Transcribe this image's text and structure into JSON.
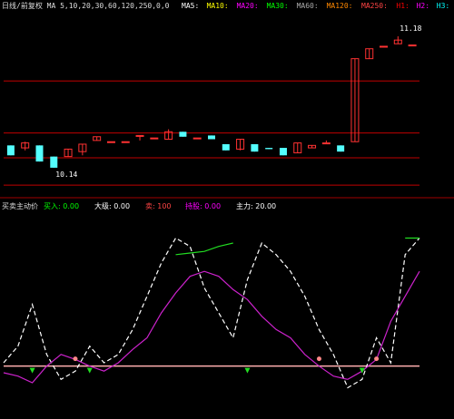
{
  "chart_data": [
    {
      "type": "candlestick",
      "panel": "price",
      "header": {
        "title": "日线/前复权",
        "ma_label": "MA",
        "ma_params": "5,10,20,30,60,120,250,0,0",
        "indicators": [
          {
            "text": "MA5:",
            "color": "#ffffff"
          },
          {
            "text": "MA10:",
            "color": "#ffff00"
          },
          {
            "text": "MA20:",
            "color": "#ff00ff"
          },
          {
            "text": "MA30:",
            "color": "#00ff00"
          },
          {
            "text": "MA60:",
            "color": "#aaaaaa"
          },
          {
            "text": "MA120:",
            "color": "#ff8800"
          },
          {
            "text": "MA250:",
            "color": "#ff4444"
          },
          {
            "text": "H1:",
            "color": "#ff0000"
          },
          {
            "text": "H2:",
            "color": "#ff00ff"
          },
          {
            "text": "H3:",
            "color": "#00ffff"
          },
          {
            "text": "H4:",
            "color": "#ffff00"
          }
        ]
      },
      "candles": [
        {
          "o": 10.3,
          "h": 10.3,
          "l": 10.22,
          "c": 10.22
        },
        {
          "o": 10.28,
          "h": 10.33,
          "l": 10.26,
          "c": 10.32
        },
        {
          "o": 10.3,
          "h": 10.3,
          "l": 10.17,
          "c": 10.17
        },
        {
          "o": 10.21,
          "h": 10.21,
          "l": 10.12,
          "c": 10.12
        },
        {
          "o": 10.21,
          "h": 10.27,
          "l": 10.21,
          "c": 10.27
        },
        {
          "o": 10.25,
          "h": 10.31,
          "l": 10.22,
          "c": 10.31
        },
        {
          "o": 10.34,
          "h": 10.37,
          "l": 10.34,
          "c": 10.37
        },
        {
          "o": 10.33,
          "h": 10.33,
          "l": 10.33,
          "c": 10.33
        },
        {
          "o": 10.33,
          "h": 10.33,
          "l": 10.33,
          "c": 10.33
        },
        {
          "o": 10.38,
          "h": 10.38,
          "l": 10.34,
          "c": 10.38
        },
        {
          "o": 10.36,
          "h": 10.36,
          "l": 10.36,
          "c": 10.36
        },
        {
          "o": 10.35,
          "h": 10.43,
          "l": 10.35,
          "c": 10.41
        },
        {
          "o": 10.41,
          "h": 10.41,
          "l": 10.37,
          "c": 10.37
        },
        {
          "o": 10.36,
          "h": 10.36,
          "l": 10.36,
          "c": 10.36
        },
        {
          "o": 10.38,
          "h": 10.38,
          "l": 10.35,
          "c": 10.35
        },
        {
          "o": 10.31,
          "h": 10.31,
          "l": 10.26,
          "c": 10.26
        },
        {
          "o": 10.27,
          "h": 10.35,
          "l": 10.26,
          "c": 10.35
        },
        {
          "o": 10.31,
          "h": 10.31,
          "l": 10.25,
          "c": 10.25
        },
        {
          "o": 10.28,
          "h": 10.28,
          "l": 10.27,
          "c": 10.27
        },
        {
          "o": 10.28,
          "h": 10.28,
          "l": 10.22,
          "c": 10.22
        },
        {
          "o": 10.24,
          "h": 10.32,
          "l": 10.24,
          "c": 10.32
        },
        {
          "o": 10.28,
          "h": 10.3,
          "l": 10.28,
          "c": 10.3
        },
        {
          "o": 10.32,
          "h": 10.34,
          "l": 10.32,
          "c": 10.32
        },
        {
          "o": 10.3,
          "h": 10.3,
          "l": 10.25,
          "c": 10.25
        },
        {
          "o": 10.33,
          "h": 11.0,
          "l": 10.33,
          "c": 11.0
        },
        {
          "o": 11.0,
          "h": 11.08,
          "l": 11.0,
          "c": 11.08
        },
        {
          "o": 11.1,
          "h": 11.1,
          "l": 11.1,
          "c": 11.1
        },
        {
          "o": 11.12,
          "h": 11.18,
          "l": 11.12,
          "c": 11.15
        },
        {
          "o": 11.11,
          "h": 11.11,
          "l": 11.11,
          "c": 11.11
        }
      ],
      "price_range": [
        9.9,
        11.4
      ],
      "annotations": [
        {
          "text": "11.18",
          "at_price": 11.18,
          "candle": 27,
          "color": "#ffffff"
        },
        {
          "text": "10.14",
          "at_price": 10.12,
          "candle": 3,
          "color": "#ffffff"
        }
      ],
      "reference_lines": [
        {
          "price": 10.82,
          "color": "#c00000"
        },
        {
          "price": 10.4,
          "color": "#c00000"
        },
        {
          "price": 10.2,
          "color": "#c00000"
        },
        {
          "price": 9.98,
          "color": "#c00000"
        }
      ],
      "colors": {
        "up": "#ff3232",
        "down": "#54ffff",
        "bg": "#000000",
        "grid": "#800000"
      }
    },
    {
      "type": "line",
      "panel": "indicator",
      "header": {
        "title": "买卖主动价",
        "items": [
          {
            "text": "买入: 0.00",
            "color": "#00ff00"
          },
          {
            "text": "大级: 0.00",
            "color": "#ffffff"
          },
          {
            "text": "卖: 100",
            "color": "#ff4444"
          },
          {
            "text": "持股: 0.00",
            "color": "#ff00ff"
          },
          {
            "text": "主力: 20.00",
            "color": "#ffffff"
          }
        ]
      },
      "y_range": [
        -10,
        110
      ],
      "series": [
        {
          "name": "white",
          "color": "#ffffff",
          "style": "dashed",
          "values": [
            20,
            30,
            55,
            25,
            10,
            15,
            30,
            20,
            25,
            40,
            60,
            80,
            95,
            90,
            65,
            50,
            35,
            70,
            92,
            85,
            75,
            60,
            40,
            25,
            5,
            10,
            35,
            20,
            85,
            95
          ]
        },
        {
          "name": "magenta",
          "color": "#cc22cc",
          "style": "solid",
          "values": [
            14,
            12,
            8,
            18,
            25,
            22,
            18,
            15,
            20,
            28,
            35,
            50,
            62,
            72,
            75,
            72,
            64,
            58,
            48,
            40,
            35,
            25,
            18,
            12,
            10,
            15,
            22,
            45,
            60,
            75
          ]
        },
        {
          "name": "green",
          "color": "#22dd22",
          "style": "solid",
          "values": [
            null,
            null,
            null,
            null,
            null,
            null,
            null,
            null,
            null,
            null,
            null,
            null,
            85,
            86,
            87,
            90,
            92,
            null,
            null,
            null,
            null,
            null,
            null,
            null,
            null,
            null,
            null,
            null,
            95,
            95
          ]
        }
      ],
      "baseline": {
        "value": 18,
        "color": "#ffb0b0"
      },
      "signals": [
        {
          "index": 2,
          "kind": "buy"
        },
        {
          "index": 6,
          "kind": "buy"
        },
        {
          "index": 17,
          "kind": "buy"
        },
        {
          "index": 25,
          "kind": "buy"
        },
        {
          "index": 5,
          "kind": "sell"
        },
        {
          "index": 22,
          "kind": "sell"
        },
        {
          "index": 26,
          "kind": "sell"
        }
      ]
    }
  ]
}
